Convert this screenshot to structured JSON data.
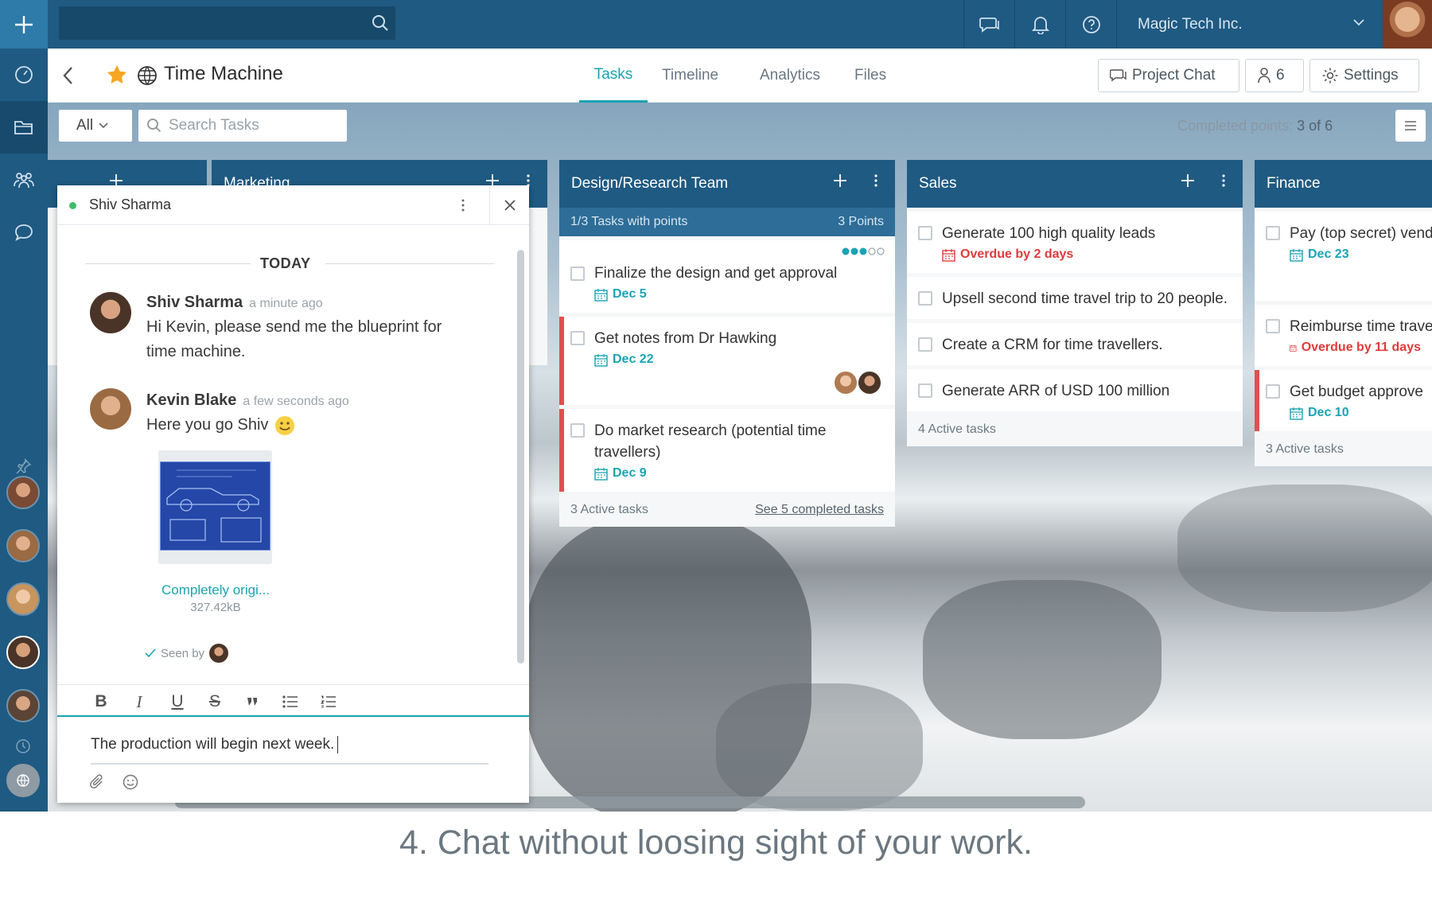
{
  "topbar": {
    "org_name": "Magic Tech Inc.",
    "search_placeholder": ""
  },
  "project": {
    "title": "Time Machine",
    "tabs": [
      {
        "label": "Tasks",
        "active": true
      },
      {
        "label": "Timeline"
      },
      {
        "label": "Analytics"
      },
      {
        "label": "Files"
      }
    ],
    "project_chat_label": "Project Chat",
    "members_count": "6",
    "settings_label": "Settings"
  },
  "toolbar": {
    "filter_label": "All",
    "search_placeholder": "Search Tasks",
    "points_label": "Completed points:",
    "points_value": "3 of 6"
  },
  "columns": [
    {
      "title": "Marketing",
      "partial": true
    },
    {
      "title": "Design/Research Team",
      "points_bar": {
        "left": "1/3 Tasks with points",
        "right": "3 Points"
      },
      "tasks": [
        {
          "text": "Finalize the design and get approval",
          "due": "Dec 5",
          "points_dots": 3,
          "points_total": 5
        },
        {
          "text": "Get notes from Dr Hawking",
          "due": "Dec 22",
          "flag": true
        },
        {
          "text": "Do market research (potential time travellers)",
          "due": "Dec 9",
          "flag": true
        }
      ],
      "footer": "3 Active tasks",
      "footer_link": "See 5 completed tasks"
    },
    {
      "title": "Sales",
      "tasks": [
        {
          "text": "Generate 100 high quality leads",
          "due": "Overdue by 2 days",
          "overdue": true
        },
        {
          "text": "Upsell second time travel trip to 20 people."
        },
        {
          "text": "Create a CRM for time travellers."
        },
        {
          "text": "Generate ARR of USD 100 million"
        }
      ],
      "footer": "4 Active tasks"
    },
    {
      "title": "Finance",
      "tasks": [
        {
          "text": "Pay (top secret) vend",
          "due": "Dec 23"
        },
        {
          "text": "Reimburse time trave",
          "due": "Overdue by 11 days",
          "overdue": true
        },
        {
          "text": "Get budget approve",
          "due": "Dec 10",
          "flag": true
        }
      ],
      "footer": "3 Active tasks"
    }
  ],
  "chat": {
    "contact": "Shiv Sharma",
    "day_label": "TODAY",
    "messages": [
      {
        "author": "Shiv Sharma",
        "time": "a minute ago",
        "text": "Hi Kevin, please send me the blueprint for time machine."
      },
      {
        "author": "Kevin Blake",
        "time": "a few seconds ago",
        "text": "Here you go Shiv"
      }
    ],
    "attachment": {
      "name": "Completely origi...",
      "size": "327.42kB"
    },
    "seen_label": "Seen by",
    "compose_text": "The production will begin next week."
  },
  "caption": "4. Chat without loosing sight of your work.",
  "colors": {
    "brand": "#1f5a82",
    "accent": "#1aa3b4",
    "danger": "#e03a3a"
  }
}
